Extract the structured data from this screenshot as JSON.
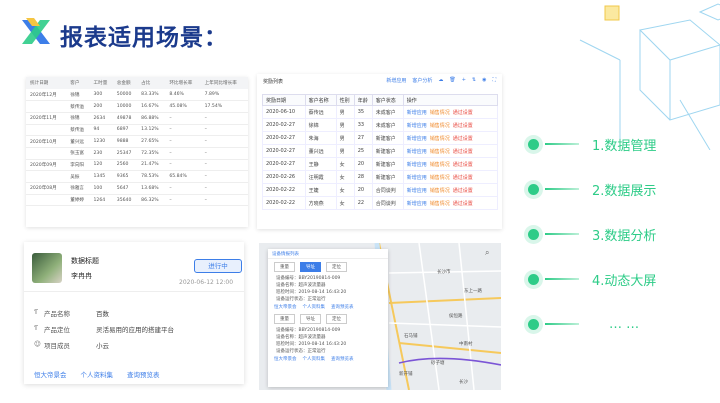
{
  "title": "报表适用场景：",
  "table1": {
    "headers": [
      "统计日期",
      "客户",
      "工时量",
      "总金额",
      "占比",
      "环比增长率",
      "上年同比增长率"
    ],
    "rows": [
      [
        "2020年12月",
        "徐锦",
        "300",
        "50000",
        "83.33%",
        "8.46%",
        "7.89%"
      ],
      [
        "",
        "蔡传溢",
        "200",
        "10000",
        "16.67%",
        "45.08%",
        "17.54%"
      ],
      [
        "2020年11月",
        "徐锦",
        "2634",
        "49878",
        "86.88%",
        "–",
        "–"
      ],
      [
        "",
        "蔡传溢",
        "94",
        "6897",
        "13.12%",
        "–",
        "–"
      ],
      [
        "2020年10月",
        "董兴远",
        "1230",
        "9888",
        "27.65%",
        "–",
        "–"
      ],
      [
        "",
        "张玉富",
        "230",
        "25347",
        "72.35%",
        "–",
        "–"
      ],
      [
        "2020年09月",
        "李向阳",
        "120",
        "2560",
        "21.47%",
        "–",
        "–"
      ],
      [
        "",
        "吴振",
        "1345",
        "9365",
        "78.53%",
        "65.84%",
        "–"
      ],
      [
        "2020年08月",
        "徐雅言",
        "100",
        "5647",
        "13.68%",
        "–",
        "–"
      ],
      [
        "",
        "董婷婷",
        "1264",
        "35640",
        "86.32%",
        "–",
        "–"
      ]
    ]
  },
  "table2": {
    "title": "奖励列表",
    "tools": [
      "新增应用",
      "客户分析"
    ],
    "headers": [
      "奖励日期",
      "客户名称",
      "性别",
      "年龄",
      "客户状态",
      "操作"
    ],
    "rows": [
      [
        "2020-06-10",
        "蔡传远",
        "男",
        "35",
        "未成客户"
      ],
      [
        "2020-02-27",
        "徐锦",
        "男",
        "33",
        "未成客户"
      ],
      [
        "2020-02-27",
        "朱海",
        "男",
        "27",
        "新建客户"
      ],
      [
        "2020-02-27",
        "董兴远",
        "男",
        "25",
        "新建客户"
      ],
      [
        "2020-02-27",
        "王静",
        "女",
        "20",
        "新建客户"
      ],
      [
        "2020-02-26",
        "汪明霞",
        "女",
        "28",
        "新建客户"
      ],
      [
        "2020-02-22",
        "王婕",
        "女",
        "20",
        "合同谈判"
      ],
      [
        "2020-02-22",
        "方晓燕",
        "女",
        "22",
        "合同谈判"
      ]
    ],
    "ops": [
      "新增应用",
      "销售情况",
      "通过设置"
    ]
  },
  "card": {
    "name": "数据标题",
    "user": "李冉冉",
    "status": "进行中",
    "date": "2020-06-12  12:00",
    "fields": [
      {
        "key": "产品名称",
        "value": "百数"
      },
      {
        "key": "产品定位",
        "value": "灵活易用的应用的搭建平台"
      },
      {
        "key": "项目成员",
        "value": "小云"
      }
    ],
    "links": [
      "恒大帝景会",
      "个人资料集",
      "查询预览表"
    ]
  },
  "map": {
    "panel_title": "设备情报列表",
    "tabs": [
      "重量",
      "导址",
      "定位"
    ],
    "entries": [
      {
        "id": "设备编号：BBY20190814-009",
        "name": "设备名称：超声波流量器",
        "time": "巡检时间：2019-08-14   16:43:20",
        "state": "设备运行状态：正常运行"
      },
      {
        "id": "设备编号：BBY20190814-009",
        "name": "设备名称：超声波流量器",
        "time": "巡检时间：2019-08-14   16:43:20",
        "state": "设备运行状态：正常运行"
      }
    ],
    "links": [
      "恒大帝景会",
      "个人资料集",
      "查询预览表"
    ],
    "labels": [
      "长沙市",
      "东上一路",
      "中南村",
      "砂子塘",
      "侯恒路",
      "石马铺",
      "新开铺",
      "长沙"
    ]
  },
  "menu": [
    {
      "label": "1.数据管理"
    },
    {
      "label": "2.数据展示"
    },
    {
      "label": "3.数据分析"
    },
    {
      "label": "4.动态大屏"
    },
    {
      "label": "… …"
    }
  ],
  "colors": {
    "accent": "#2ecc88",
    "title": "#1b3a8c",
    "link": "#3d7ee8"
  }
}
